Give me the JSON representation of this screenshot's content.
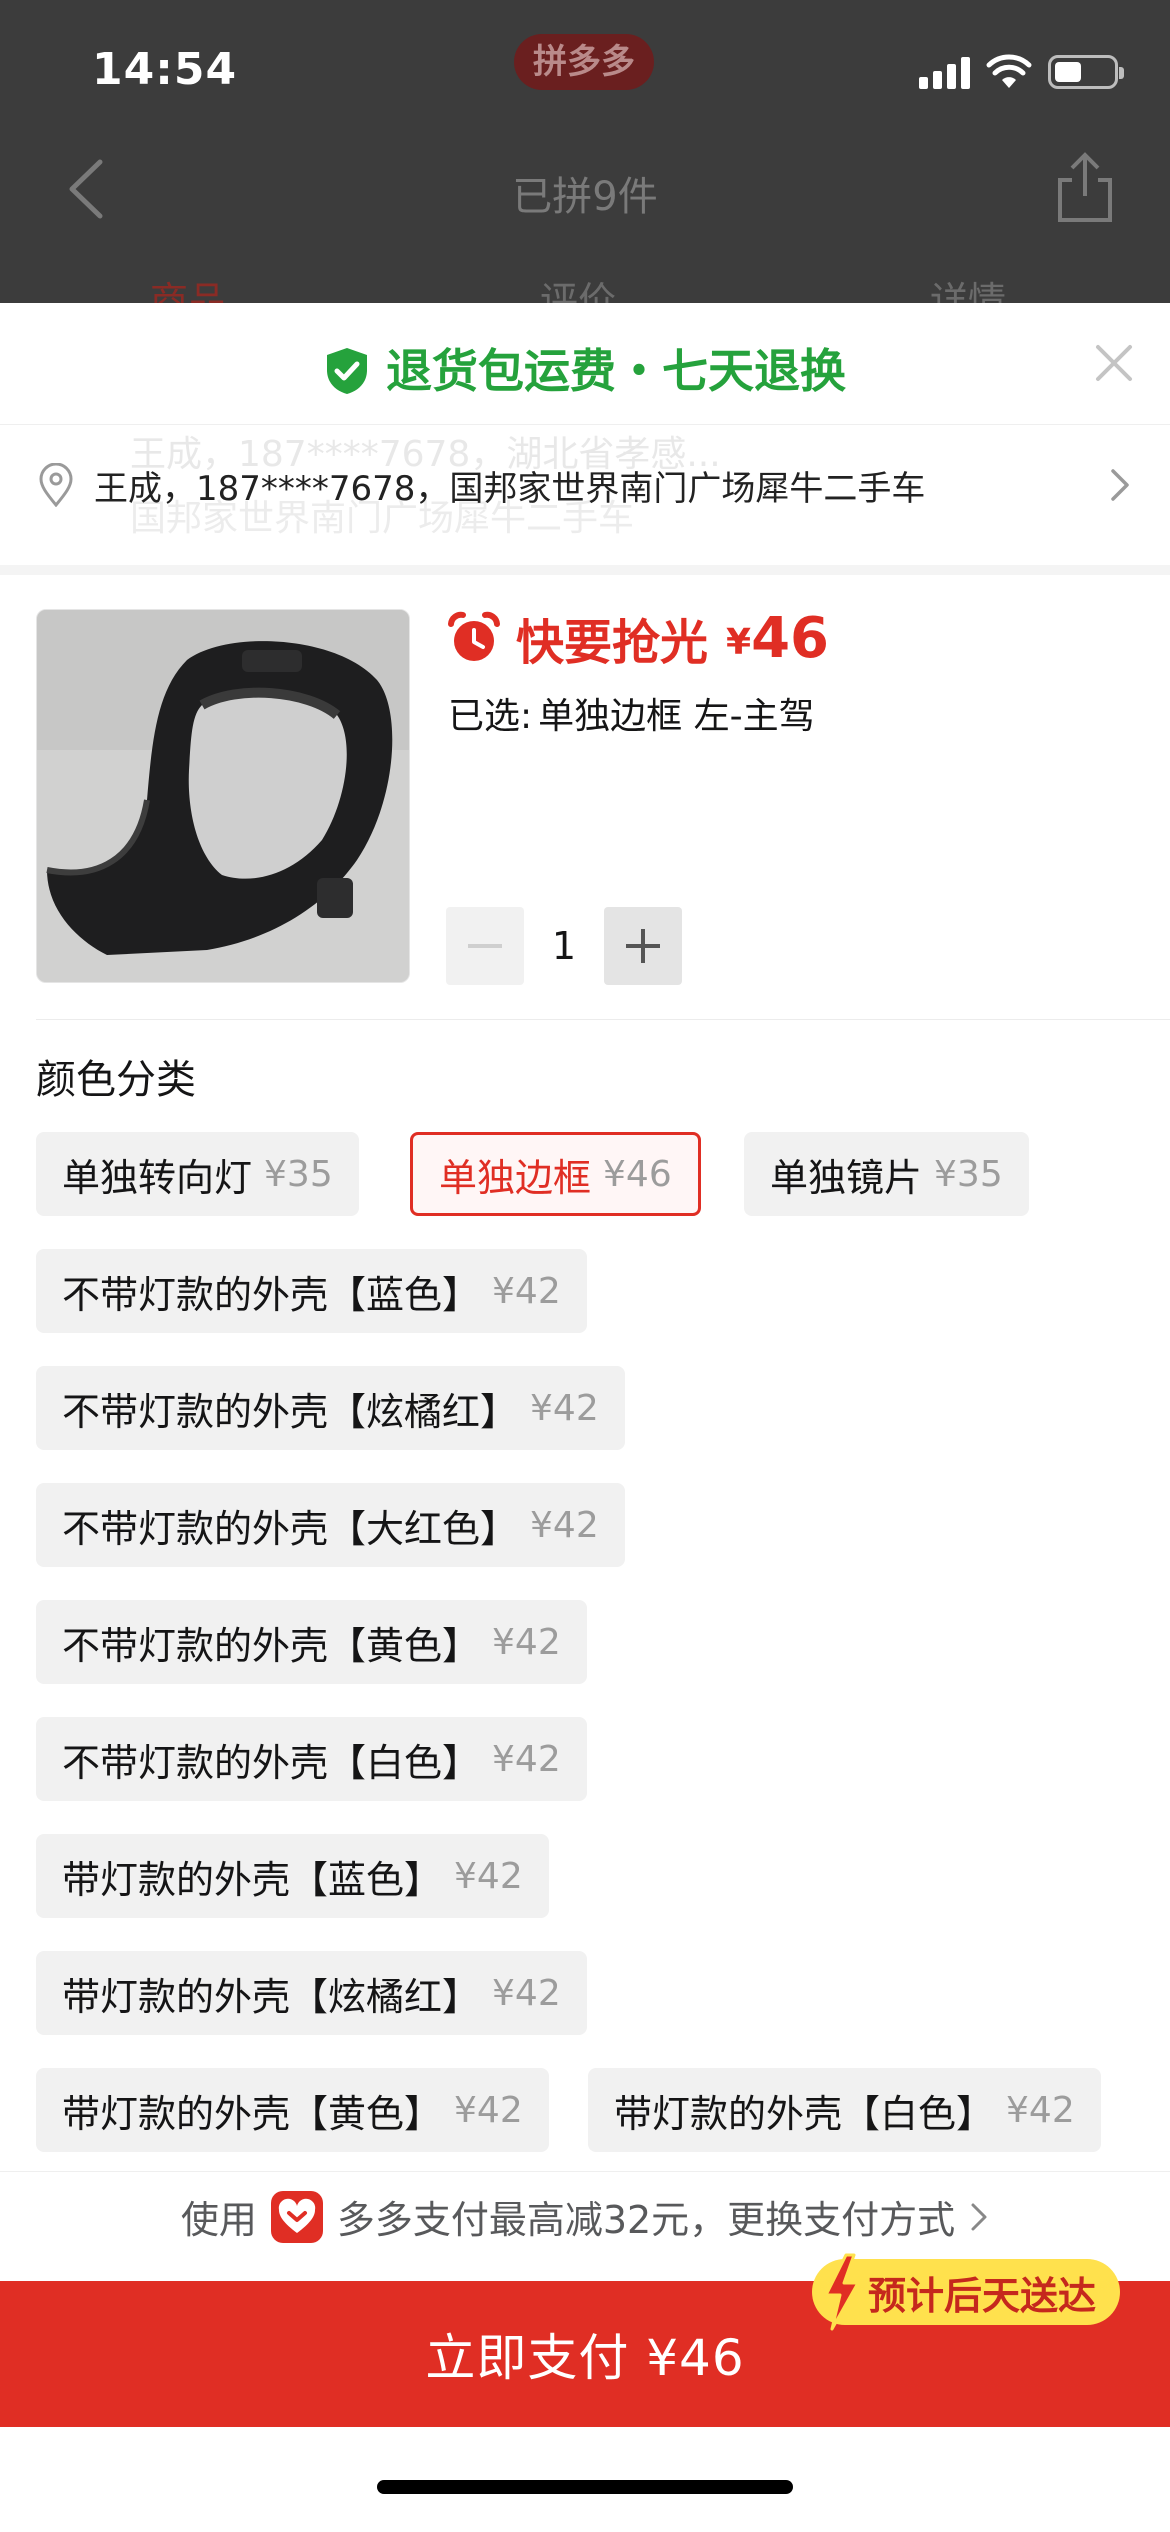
{
  "status_bar": {
    "time": "14:54",
    "logo_text": "拼多多"
  },
  "nav": {
    "title": "已拼9件"
  },
  "bg_tabs": [
    "商品",
    "评价",
    "详情"
  ],
  "refund_banner": {
    "text": "退货包运费・七天退换"
  },
  "address": {
    "text": "王成，187****7678，国邦家世界南门广场犀牛二手车",
    "ghost_line1": "王成，187****7678，湖北省孝感...",
    "ghost_line2": "国邦家世界南门广场犀牛二手车"
  },
  "product": {
    "promo_text": "快要抢光",
    "currency": "¥",
    "price": "46",
    "selected_label": "已选:",
    "selected_value": "单独边框 左-主驾",
    "quantity": "1"
  },
  "sku_section": {
    "title": "颜色分类",
    "options": [
      {
        "name": "单独转向灯",
        "price": "¥35",
        "selected": false
      },
      {
        "name": "单独边框",
        "price": "¥46",
        "selected": true
      },
      {
        "name": "单独镜片",
        "price": "¥35",
        "selected": false
      },
      {
        "name": "不带灯款的外壳【蓝色】",
        "price": "¥42",
        "selected": false
      },
      {
        "name": "不带灯款的外壳【炫橘红】",
        "price": "¥42",
        "selected": false
      },
      {
        "name": "不带灯款的外壳【大红色】",
        "price": "¥42",
        "selected": false
      },
      {
        "name": "不带灯款的外壳【黄色】",
        "price": "¥42",
        "selected": false
      },
      {
        "name": "不带灯款的外壳【白色】",
        "price": "¥42",
        "selected": false
      },
      {
        "name": "带灯款的外壳【蓝色】",
        "price": "¥42",
        "selected": false
      },
      {
        "name": "带灯款的外壳【炫橘红】",
        "price": "¥42",
        "selected": false
      },
      {
        "name": "带灯款的外壳【黄色】",
        "price": "¥42",
        "selected": false
      },
      {
        "name": "带灯款的外壳【白色】",
        "price": "¥42",
        "selected": false
      }
    ]
  },
  "pay_hint": {
    "prefix": "使用",
    "text": "多多支付最高减32元，更换支付方式"
  },
  "delivery_badge": "预计后天送达",
  "pay_button": "立即支付 ¥46",
  "colors": {
    "brand_red": "#e02e24",
    "green": "#25a23c",
    "badge_yellow": "#ffe14d"
  }
}
